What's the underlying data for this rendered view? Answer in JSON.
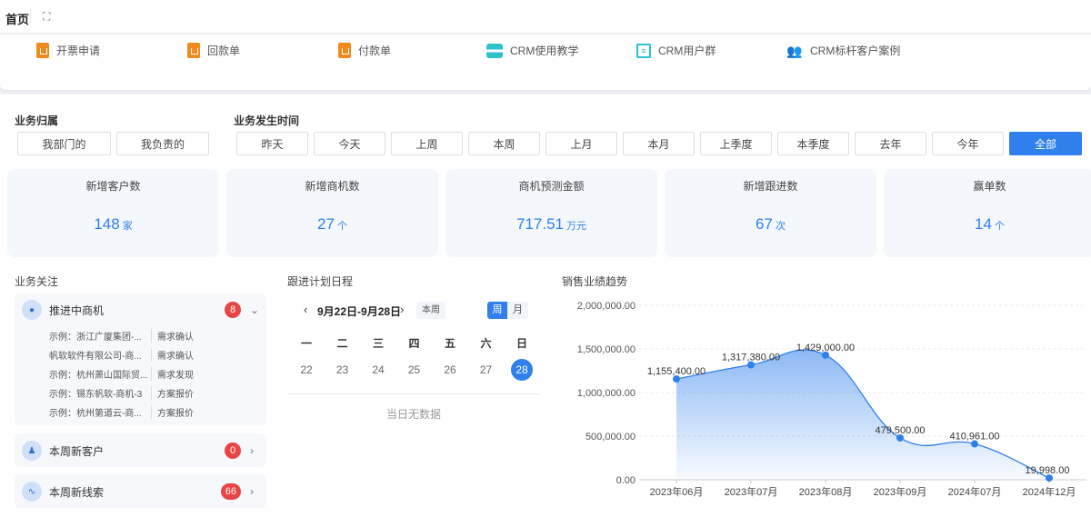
{
  "header": {
    "home": "首页",
    "expand_icon": "fullscreen-icon"
  },
  "shortcuts": [
    {
      "label": "开票申请",
      "icon": "clipboard-icon"
    },
    {
      "label": "回款单",
      "icon": "clipboard-icon"
    },
    {
      "label": "付款单",
      "icon": "clipboard-icon"
    },
    {
      "label": "CRM使用教学",
      "icon": "book-icon"
    },
    {
      "label": "CRM用户群",
      "icon": "group-chat-icon"
    },
    {
      "label": "CRM标杆客户案例",
      "icon": "users-icon"
    }
  ],
  "filters": {
    "ownership_label": "业务归属",
    "ownership": [
      "我部门的",
      "我负责的"
    ],
    "time_label": "业务发生时间",
    "time": [
      "昨天",
      "今天",
      "上周",
      "本周",
      "上月",
      "本月",
      "上季度",
      "本季度",
      "去年",
      "今年",
      "全部"
    ],
    "time_selected": "全部"
  },
  "stats": [
    {
      "title": "新增客户数",
      "value": "148",
      "unit": "家"
    },
    {
      "title": "新增商机数",
      "value": "27",
      "unit": "个"
    },
    {
      "title": "商机预测金额",
      "value": "717.51",
      "unit": "万元"
    },
    {
      "title": "新增跟进数",
      "value": "67",
      "unit": "次"
    },
    {
      "title": "赢单数",
      "value": "14",
      "unit": "个"
    }
  ],
  "focus": {
    "title": "业务关注",
    "panels": [
      {
        "title": "推进中商机",
        "count": "8",
        "rows": [
          {
            "name": "示例：浙江广厦集团-...",
            "stage": "需求确认"
          },
          {
            "name": "帆软软件有限公司-商...",
            "stage": "需求确认"
          },
          {
            "name": "示例：杭州萧山国际贸...",
            "stage": "需求发现"
          },
          {
            "name": "示例：锡东帆软-商机-3",
            "stage": "方案报价"
          },
          {
            "name": "示例：杭州第道云-商...",
            "stage": "方案报价"
          }
        ]
      },
      {
        "title": "本周新客户",
        "count": "0"
      },
      {
        "title": "本周新线索",
        "count": "66"
      }
    ]
  },
  "schedule": {
    "title": "跟进计划日程",
    "range": "9月22日-9月28日",
    "this_week": "本周",
    "view_week": "周",
    "view_month": "月",
    "weekdays": [
      "一",
      "二",
      "三",
      "四",
      "五",
      "六",
      "日"
    ],
    "days": [
      "22",
      "23",
      "24",
      "25",
      "26",
      "27",
      "28"
    ],
    "selected_day": "28",
    "empty": "当日无数据"
  },
  "chart_data": {
    "type": "area",
    "title": "销售业绩趋势",
    "categories": [
      "2023年06月",
      "2023年07月",
      "2023年08月",
      "2023年09月",
      "2024年07月",
      "2024年12月"
    ],
    "values": [
      1155400,
      1317380,
      1429000,
      479500,
      410961,
      19998
    ],
    "value_labels": [
      "1,155,400.00",
      "1,317,380.00",
      "1,429,000.00",
      "479,500.00",
      "410,961.00",
      "19,998.00"
    ],
    "yticks": [
      "0.00",
      "500,000.00",
      "1,000,000.00",
      "1,500,000.00",
      "2,000,000.00"
    ],
    "ylim": [
      0,
      2000000
    ],
    "grid": true,
    "color": "#2f80ed"
  }
}
